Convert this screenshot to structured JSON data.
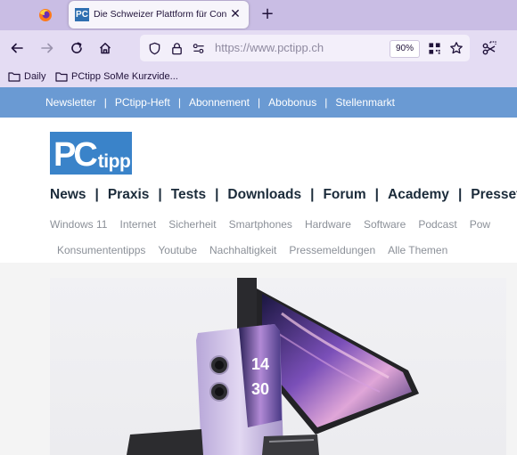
{
  "browser": {
    "tab": {
      "favicon_text": "PC",
      "title": "Die Schweizer Plattform für Con",
      "close_icon": "close-icon",
      "new_tab_icon": "plus-icon"
    },
    "address_bar": {
      "url": "https://www.pctipp.ch",
      "zoom": "90%"
    },
    "bookmarks": [
      {
        "label": "Daily",
        "icon": "folder-icon"
      },
      {
        "label": "PCtipp SoMe Kurzvide...",
        "icon": "folder-icon"
      }
    ],
    "colors": {
      "tabbar": "#c9bde4",
      "toolbar": "#e4dcf3"
    }
  },
  "site": {
    "top_links": [
      "Newsletter",
      "PCtipp-Heft",
      "Abonnement",
      "Abobonus",
      "Stellenmarkt"
    ],
    "top_separator": "|",
    "logo": {
      "pc": "PC",
      "tipp": "tipp"
    },
    "main_nav": [
      "News",
      "Praxis",
      "Tests",
      "Downloads",
      "Forum",
      "Academy",
      "Pressetic"
    ],
    "main_separator": "|",
    "sub_nav_row1": [
      "Windows 11",
      "Internet",
      "Sicherheit",
      "Smartphones",
      "Hardware",
      "Software",
      "Podcast",
      "Pow"
    ],
    "sub_nav_row2": [
      "Konsumententipps",
      "Youtube",
      "Nachhaltigkeit",
      "Pressemeldungen",
      "Alle Themen"
    ],
    "hero": {
      "phone_time_hour": "14",
      "phone_time_min": "30"
    },
    "colors": {
      "top_bar": "#6a9ad3",
      "logo": "#3a83c9"
    }
  }
}
